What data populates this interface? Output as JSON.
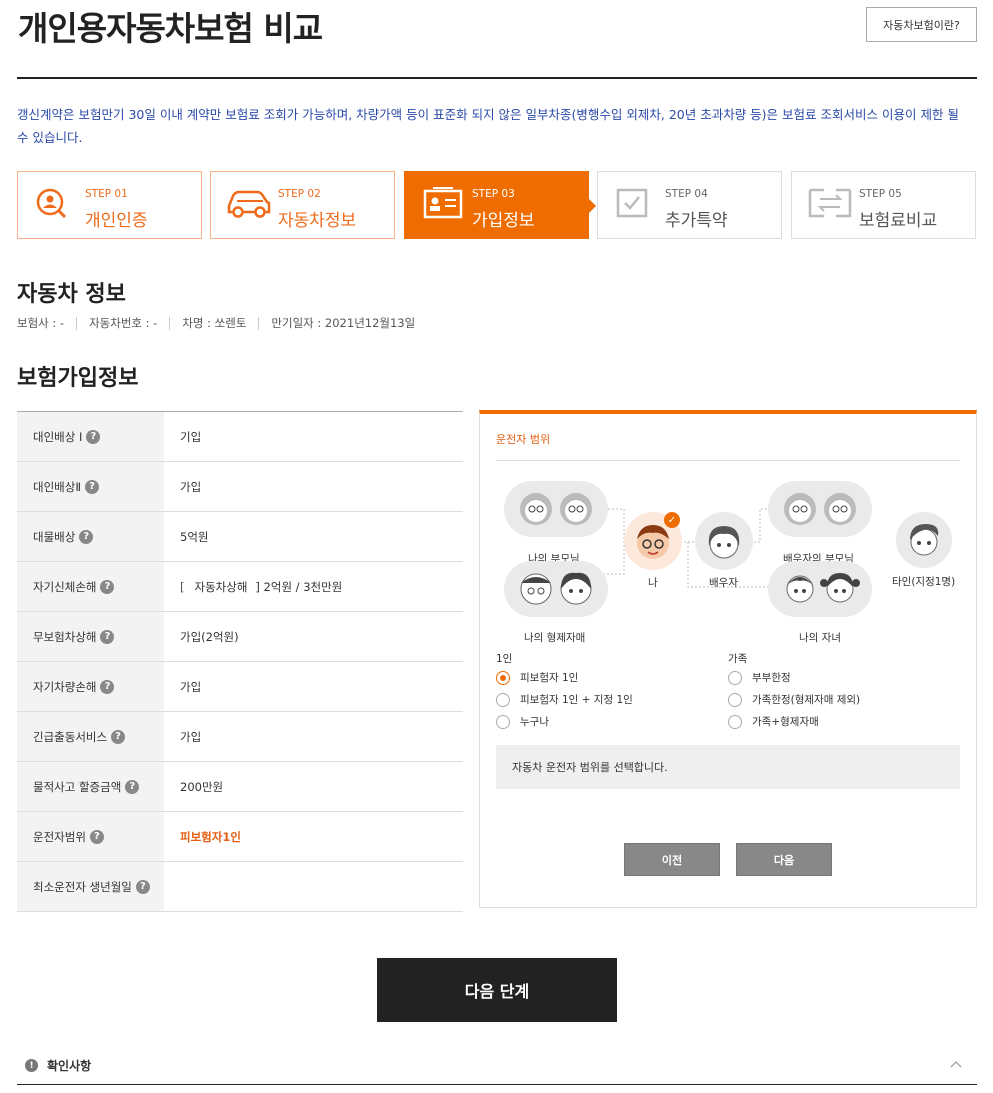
{
  "page": {
    "title": "개인용자동차보험 비교",
    "info_button": "자동차보험이란?",
    "notice": "갱신계약은 보험만기 30일 이내 계약만 보험료 조회가 가능하며, 차량가액 등이 표준화 되지 않은 일부차종(병행수입 외제차, 20년 초과차량 등)은 보험료 조회서비스 이용이 제한 될 수 있습니다."
  },
  "steps": [
    {
      "num": "STEP 01",
      "label": "개인인증",
      "state": "done",
      "icon": "person-search-icon"
    },
    {
      "num": "STEP 02",
      "label": "자동차정보",
      "state": "done",
      "icon": "car-icon"
    },
    {
      "num": "STEP 03",
      "label": "가입정보",
      "state": "active",
      "icon": "id-card-icon"
    },
    {
      "num": "STEP 04",
      "label": "추가특약",
      "state": "todo",
      "icon": "checkbox-icon"
    },
    {
      "num": "STEP 05",
      "label": "보험료비교",
      "state": "todo",
      "icon": "compare-icon"
    }
  ],
  "car_section": {
    "title": "자동차 정보",
    "items": [
      "보험사 : -",
      "자동차번호 : -",
      "차명 : 쏘렌토",
      "만기일자 : 2021년12월13일"
    ]
  },
  "insurance_section": {
    "title": "보험가입정보",
    "rows": [
      {
        "label": "대인배상 I",
        "value": "기입"
      },
      {
        "label": "대인배상Ⅱ",
        "value": "가입"
      },
      {
        "label": "대물배상",
        "value": "5억원"
      },
      {
        "label": "자기신체손해",
        "value_prefix": "[",
        "value_mid": "자동차상해",
        "value_suffix": "] 2억원 / 3천만원"
      },
      {
        "label": "무보험차상해",
        "value": "가입(2억원)"
      },
      {
        "label": "자기차량손해",
        "value": "가입"
      },
      {
        "label": "긴급출동서비스",
        "value": "가입"
      },
      {
        "label": "물적사고 할증금액",
        "value": "200만원"
      },
      {
        "label": "운전자범위",
        "value": "피보험자1인",
        "highlight": true
      },
      {
        "label": "최소운전자 생년월일",
        "value": ""
      }
    ]
  },
  "driver_panel": {
    "title": "운전자 범위",
    "nodes": {
      "my_parents": "나의 부모님",
      "my_siblings": "나의 형제자매",
      "me": "나",
      "spouse": "배우자",
      "spouse_parents": "배우자의 부모님",
      "my_children": "나의 자녀",
      "other": "타인(지정1명)"
    },
    "group_single": "1인",
    "group_family": "가족",
    "options_single": [
      "피보험자 1인",
      "피보험자 1인 + 지정 1인",
      "누구나"
    ],
    "options_family": [
      "부부한정",
      "가족한정(형제자매 제외)",
      "가족+형제자매"
    ],
    "selected": "피보험자 1인",
    "description": "자동차 운전자 범위를 선택합니다.",
    "prev_button": "이전",
    "next_button": "다음"
  },
  "next_step_button": "다음 단계",
  "confirm_section": {
    "title": "확인사항",
    "icon": "info-icon"
  },
  "colors": {
    "accent": "#ef6c00",
    "notice": "#2b4aa8",
    "dark": "#222222"
  }
}
